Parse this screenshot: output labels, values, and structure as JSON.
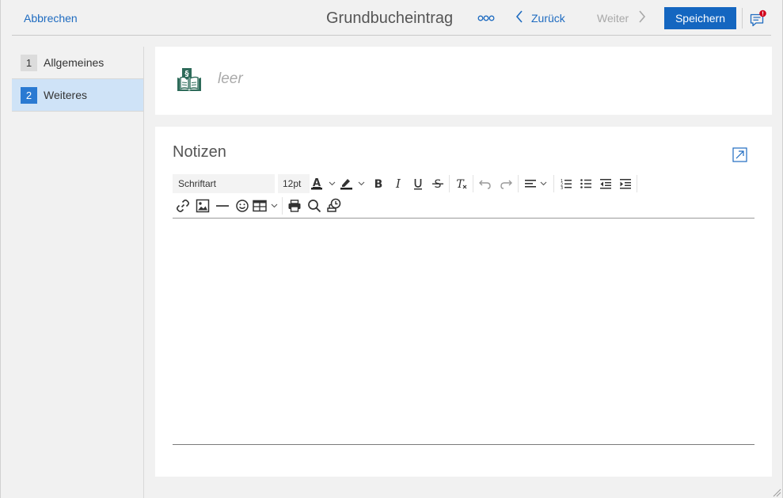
{
  "header": {
    "cancel_label": "Abbrechen",
    "title": "Grundbucheintrag",
    "more_icon": "more-dots-icon",
    "back_label": "Zurück",
    "next_label": "Weiter",
    "save_label": "Speichern",
    "comment_icon": "comment-alert-icon"
  },
  "sidebar": {
    "steps": [
      {
        "number": "1",
        "label": "Allgemeines",
        "active": false
      },
      {
        "number": "2",
        "label": "Weiteres",
        "active": true
      }
    ]
  },
  "summary": {
    "icon": "land-register-book-icon",
    "text": "leer"
  },
  "notes": {
    "title": "Notizen",
    "font_value": "Schriftart",
    "size_value": "12pt",
    "content": ""
  },
  "colors": {
    "accent": "#1466c0",
    "link": "#1e6bc0",
    "icon_green": "#2e6b5a",
    "active_step_bg": "#cfe3f7",
    "alert": "#d0021b"
  }
}
